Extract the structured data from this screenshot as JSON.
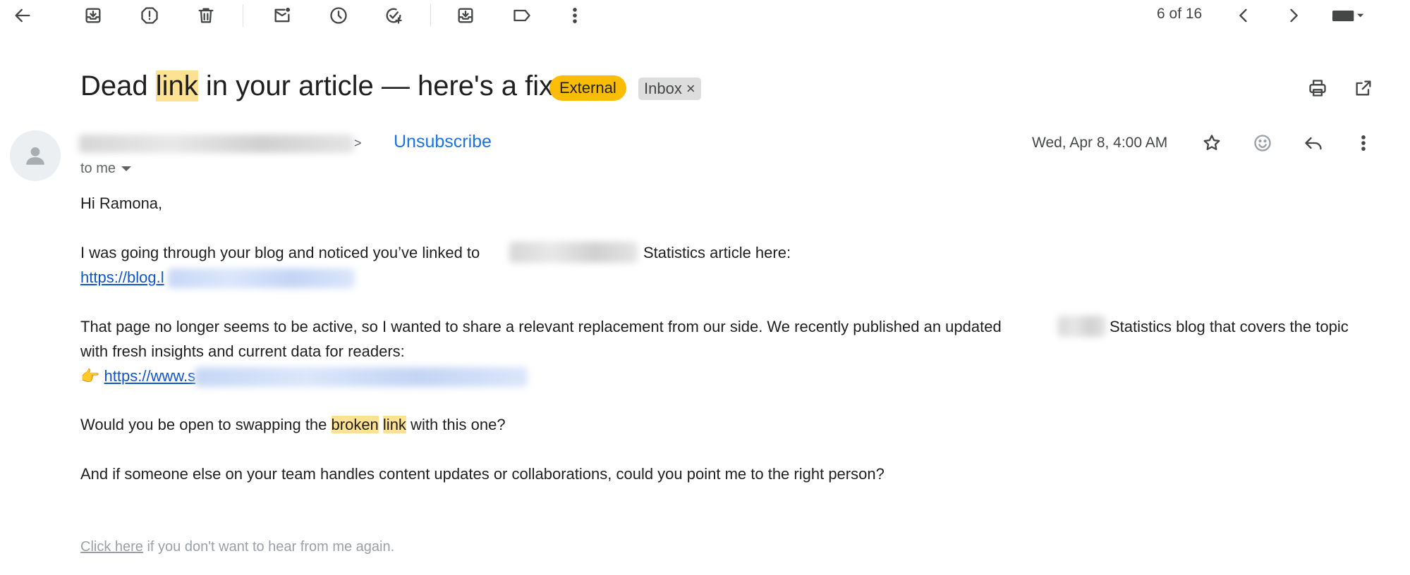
{
  "toolbar": {
    "counter": "6 of 16"
  },
  "email": {
    "subject_before": "Dead ",
    "subject_highlight": "link",
    "subject_after": " in your article — here's a fix",
    "label_external": "External",
    "label_inbox": "Inbox",
    "label_remove": "×",
    "sender_suffix": ">",
    "unsubscribe": "Unsubscribe",
    "date": "Wed, Apr 8, 4:00 AM",
    "to_me": "to me",
    "greeting": "Hi Ramona,",
    "p1_before": "I was going through your blog and noticed you’ve linked to",
    "p1_after": "Statistics article here:",
    "link1_visible": "https://blog.l",
    "p2_line1_before": "That page no longer seems to be active, so I wanted to share a relevant replacement from our side. We recently published an updated",
    "p2_line1_after": "Statistics blog that covers the topic",
    "p2_line2": "with fresh insights and current data for readers:",
    "pointer_emoji": "👉",
    "link2_visible": "https://www.s",
    "q_before": "Would you be open to swapping the ",
    "q_hl1": "broken",
    "q_hl2": "link",
    "q_after": " with this one?",
    "p4": "And if someone else on your team handles content updates or collaborations, could you point me to the right person?",
    "footer_link": "Click here",
    "footer_text": " if you don't want to hear from me again."
  },
  "icons": [
    "back-arrow-icon",
    "archive-icon",
    "report-spam-icon",
    "delete-icon",
    "mark-unread-icon",
    "snooze-icon",
    "add-to-tasks-icon",
    "move-to-icon",
    "label-icon",
    "more-vert-icon",
    "chevron-left-icon",
    "chevron-right-icon",
    "keyboard-icon",
    "print-icon",
    "open-new-window-icon",
    "star-icon",
    "emoji-icon",
    "reply-icon",
    "person-icon"
  ],
  "colors": {
    "accent_link": "#1155cc",
    "unsubscribe": "#1a73e8",
    "external_badge": "#fbbc04",
    "highlight": "#fde293"
  }
}
